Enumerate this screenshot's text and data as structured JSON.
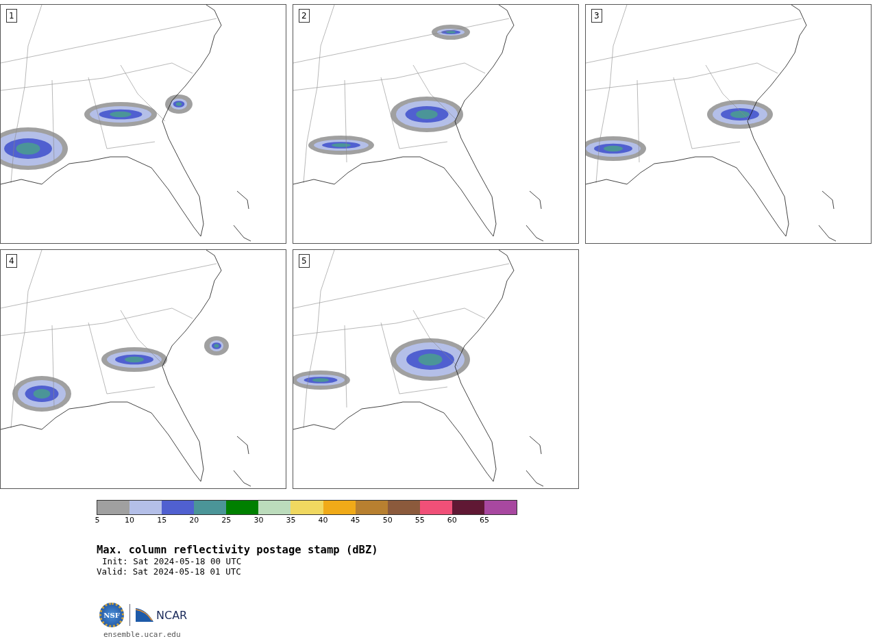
{
  "panels": [
    {
      "label": "1"
    },
    {
      "label": "2"
    },
    {
      "label": "3"
    },
    {
      "label": "4"
    },
    {
      "label": "5"
    }
  ],
  "colorbar": [
    {
      "color": "#a0a0a0",
      "tick": "5"
    },
    {
      "color": "#b4bfe8",
      "tick": "10"
    },
    {
      "color": "#5060d0",
      "tick": "15"
    },
    {
      "color": "#4b9598",
      "tick": "20"
    },
    {
      "color": "#008000",
      "tick": "25"
    },
    {
      "color": "#bcdcbc",
      "tick": "30"
    },
    {
      "color": "#f0d860",
      "tick": "35"
    },
    {
      "color": "#f0aa18",
      "tick": "40"
    },
    {
      "color": "#b88030",
      "tick": "45"
    },
    {
      "color": "#8b5a3c",
      "tick": "50"
    },
    {
      "color": "#f05078",
      "tick": "55"
    },
    {
      "color": "#601834",
      "tick": "60"
    },
    {
      "color": "#a848a0",
      "tick": "65"
    }
  ],
  "title": "Max. column reflectivity postage stamp (dBZ)",
  "init": "Init: Sat 2024-05-18 00 UTC",
  "valid": "Valid: Sat 2024-05-18 01 UTC",
  "footer": {
    "nsf": "NSF",
    "ncar": "NCAR",
    "url": "ensemble.ucar.edu"
  }
}
